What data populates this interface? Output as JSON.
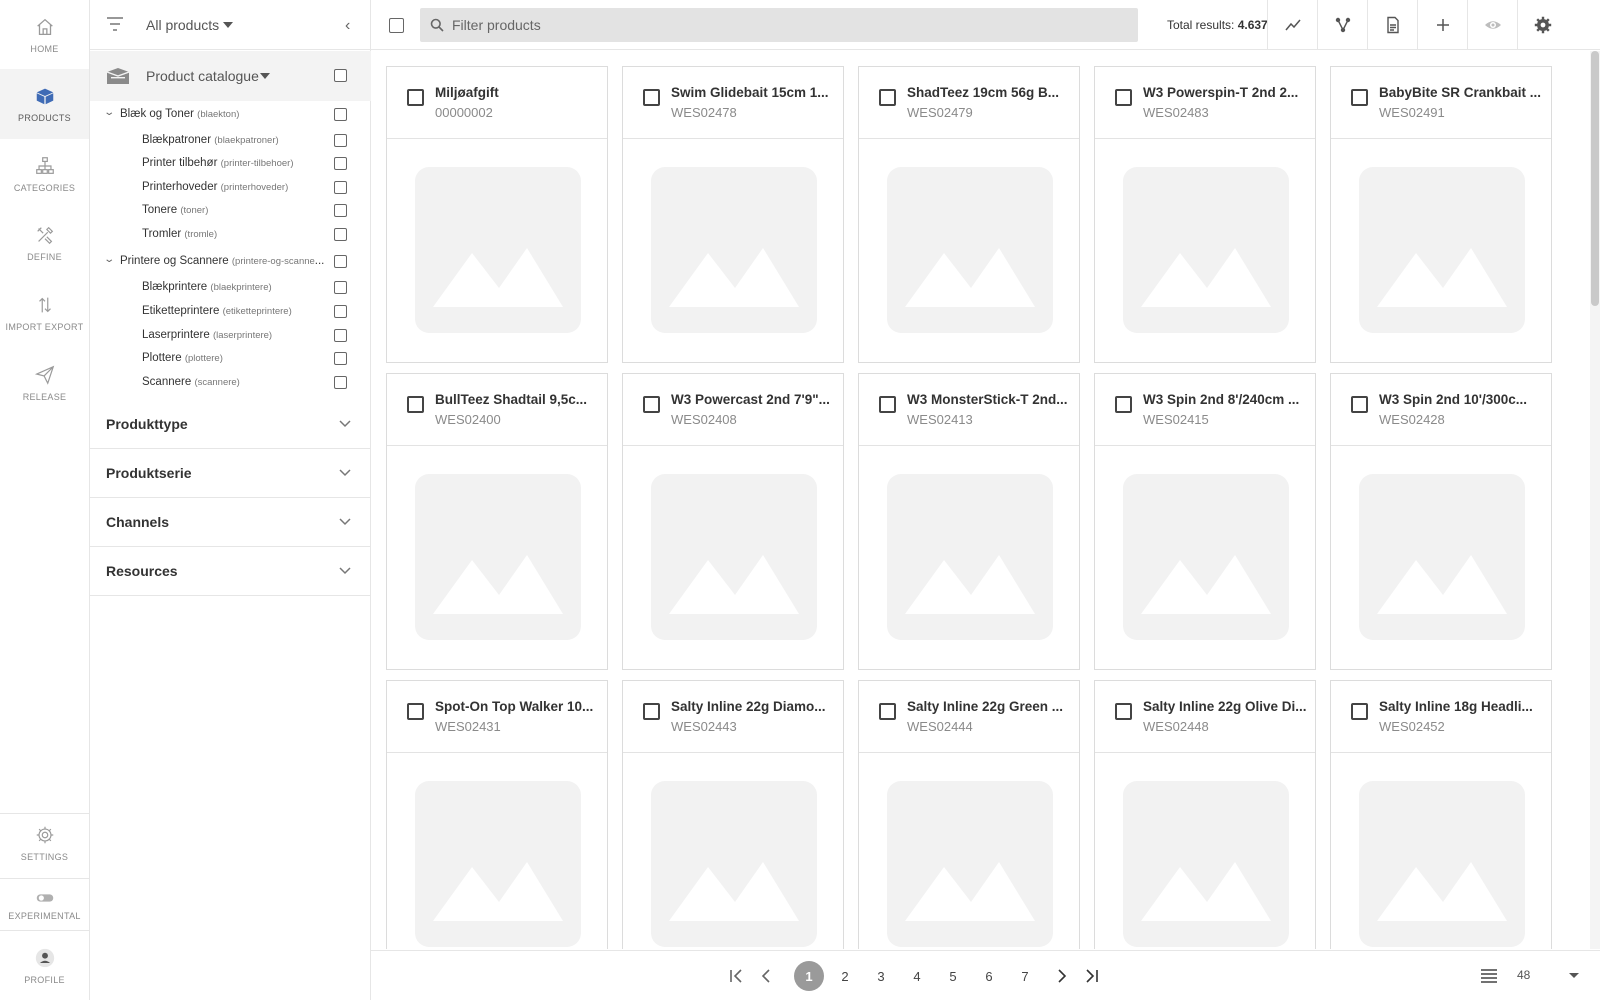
{
  "nav": {
    "items": [
      {
        "label": "HOME",
        "icon": "home-icon"
      },
      {
        "label": "PRODUCTS",
        "icon": "box-icon"
      },
      {
        "label": "CATEGORIES",
        "icon": "hierarchy-icon"
      },
      {
        "label": "DEFINE",
        "icon": "tools-icon"
      },
      {
        "label": "IMPORT EXPORT",
        "icon": "arrows-updown-icon"
      },
      {
        "label": "RELEASE",
        "icon": "paper-plane-icon"
      }
    ],
    "bottom": [
      {
        "label": "SETTINGS",
        "icon": "gear-icon"
      },
      {
        "label": "EXPERIMENTAL",
        "icon": "toggle-icon"
      },
      {
        "label": "PROFILE",
        "icon": "user-icon"
      }
    ],
    "active_color": "#3f6bb5"
  },
  "filters": {
    "scope": "All products",
    "catalogue": "Product catalogue",
    "tree": [
      {
        "label": "Blæk og Toner",
        "slug": "(blaekton)",
        "expanded": true,
        "children": [
          {
            "label": "Blækpatroner",
            "slug": "(blaekpatroner)"
          },
          {
            "label": "Printer tilbehør",
            "slug": "(printer-tilbehoer)"
          },
          {
            "label": "Printerhoveder",
            "slug": "(printerhoveder)"
          },
          {
            "label": "Tonere",
            "slug": "(toner)"
          },
          {
            "label": "Tromler",
            "slug": "(tromle)"
          }
        ]
      },
      {
        "label": "Printere og Scannere",
        "slug": "(printere-og-scanne",
        "expanded": true,
        "children": [
          {
            "label": "Blækprintere",
            "slug": "(blaekprintere)"
          },
          {
            "label": "Etiketteprintere",
            "slug": "(etiketteprintere)"
          },
          {
            "label": "Laserprintere",
            "slug": "(laserprintere)"
          },
          {
            "label": "Plottere",
            "slug": "(plottere)"
          },
          {
            "label": "Scannere",
            "slug": "(scannere)"
          }
        ]
      }
    ],
    "facets": [
      "Produkttype",
      "Produktserie",
      "Channels",
      "Resources"
    ]
  },
  "toolbar": {
    "search_placeholder": "Filter products",
    "total_label": "Total results:",
    "total_value": "4.637",
    "buttons": [
      "chart-icon",
      "share-icon",
      "report-icon",
      "plus-icon",
      "eye-icon",
      "gear-icon"
    ]
  },
  "products": [
    {
      "title": "Miljøafgift",
      "sku": "00000002"
    },
    {
      "title": "Swim Glidebait 15cm 1...",
      "sku": "WES02478"
    },
    {
      "title": "ShadTeez 19cm 56g B...",
      "sku": "WES02479"
    },
    {
      "title": "W3 Powerspin-T 2nd 2...",
      "sku": "WES02483"
    },
    {
      "title": "BabyBite SR Crankbait ...",
      "sku": "WES02491"
    },
    {
      "title": "BullTeez Shadtail 9,5c...",
      "sku": "WES02400"
    },
    {
      "title": "W3 Powercast 2nd 7'9\"...",
      "sku": "WES02408"
    },
    {
      "title": "W3 MonsterStick-T 2nd...",
      "sku": "WES02413"
    },
    {
      "title": "W3 Spin 2nd 8'/240cm ...",
      "sku": "WES02415"
    },
    {
      "title": "W3 Spin 2nd 10'/300c...",
      "sku": "WES02428"
    },
    {
      "title": "Spot-On Top Walker 10...",
      "sku": "WES02431"
    },
    {
      "title": "Salty Inline 22g Diamo...",
      "sku": "WES02443"
    },
    {
      "title": "Salty Inline 22g Green ...",
      "sku": "WES02444"
    },
    {
      "title": "Salty Inline 22g Olive Di...",
      "sku": "WES02448"
    },
    {
      "title": "Salty Inline 18g Headli...",
      "sku": "WES02452"
    }
  ],
  "pagination": {
    "pages": [
      "1",
      "2",
      "3",
      "4",
      "5",
      "6",
      "7"
    ],
    "current": "1",
    "per_page": "48"
  }
}
